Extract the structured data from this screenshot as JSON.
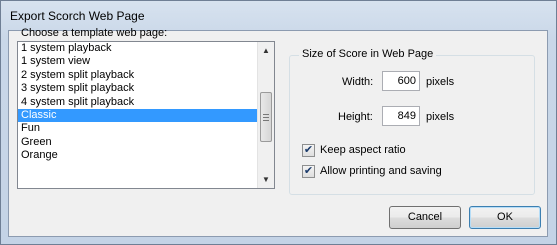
{
  "window": {
    "title": "Export Scorch Web Page"
  },
  "templates": {
    "label": "Choose a template web page:",
    "items": [
      "1 system playback",
      "1 system view",
      "2 system split playback",
      "3 system split playback",
      "4 system split playback",
      "Classic",
      "Fun",
      "Green",
      "Orange"
    ],
    "selected": "Classic"
  },
  "size": {
    "group_title": "Size of Score in Web Page",
    "width_label": "Width:",
    "width_value": "600",
    "width_unit": "pixels",
    "height_label": "Height:",
    "height_value": "849",
    "height_unit": "pixels"
  },
  "options": {
    "keep_aspect_label": "Keep aspect ratio",
    "keep_aspect_checked": true,
    "allow_print_label": "Allow printing and saving",
    "allow_print_checked": true
  },
  "buttons": {
    "cancel": "Cancel",
    "ok": "OK"
  },
  "icons": {
    "scroll_up": "triangle-up",
    "scroll_down": "triangle-down",
    "check": "check-mark"
  }
}
